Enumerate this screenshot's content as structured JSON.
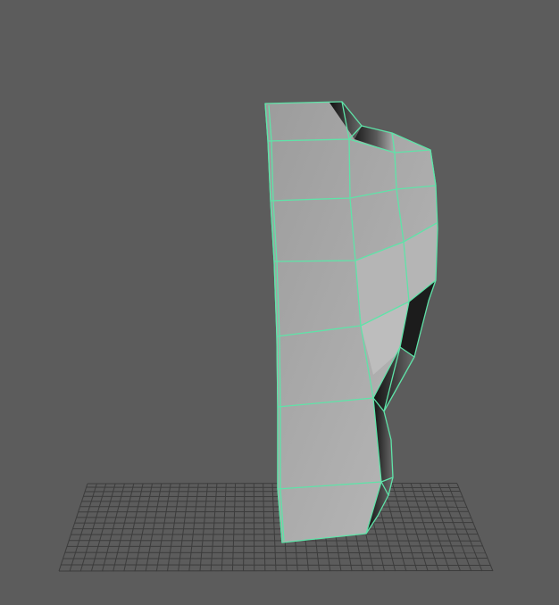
{
  "viewport": {
    "background": "#5c5c5c",
    "grid_color": "#3c3c3c",
    "wireframe_color": "#5fe3a8",
    "mesh_fill": "#a9a9a9",
    "mesh_shadow": "#1a1a1a",
    "mesh_selected": true
  }
}
